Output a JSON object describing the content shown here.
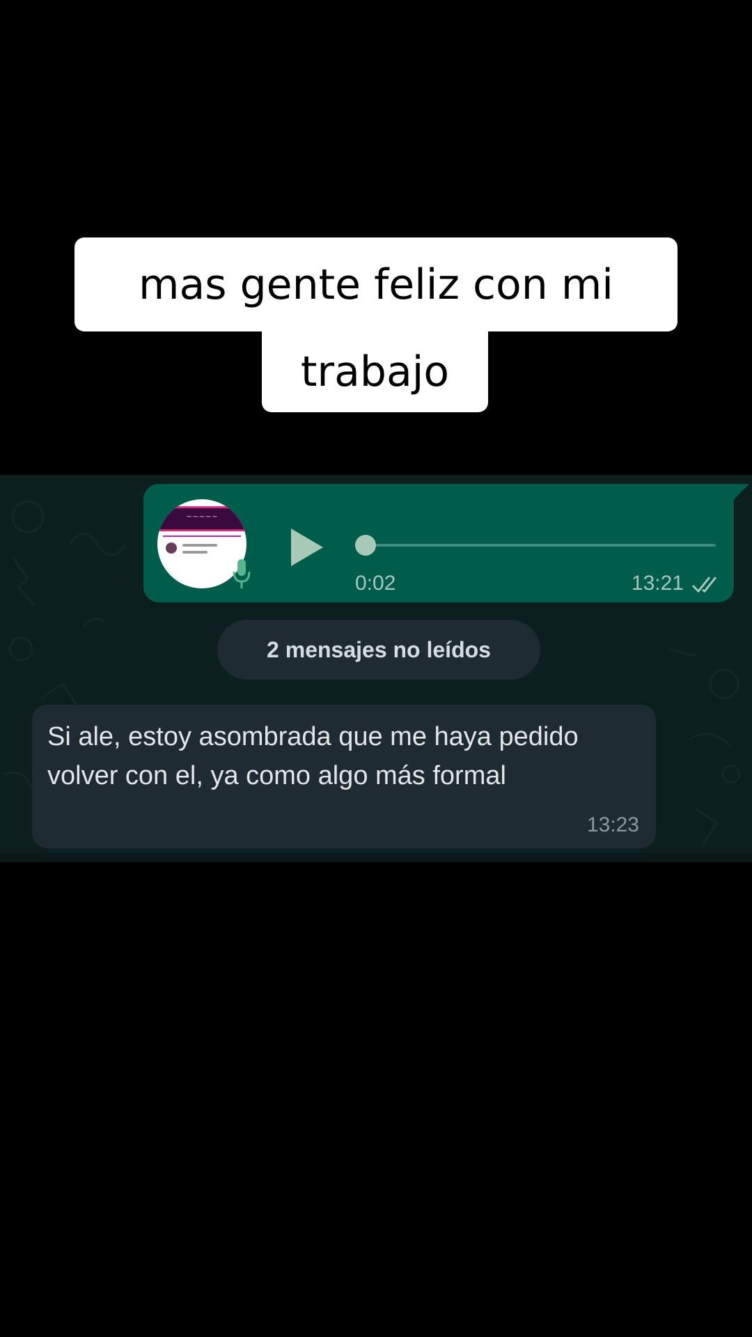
{
  "caption": {
    "line1": "mas gente feliz con mi",
    "line2": "trabajo"
  },
  "voice_message": {
    "duration": "0:02",
    "time": "13:21",
    "progress": 0,
    "status_icon": "double-check-icon",
    "play_icon": "play-icon",
    "mic_icon": "microphone-icon",
    "bubble_color": "#005c4b"
  },
  "unread_banner": {
    "label": "2 mensajes no leídos"
  },
  "incoming_message": {
    "text": "Si ale, estoy asombrada que me haya pedido volver con el, ya como algo más formal",
    "time": "13:23",
    "bubble_color": "#1f2b32"
  },
  "chat_background": "#0d1e1f"
}
